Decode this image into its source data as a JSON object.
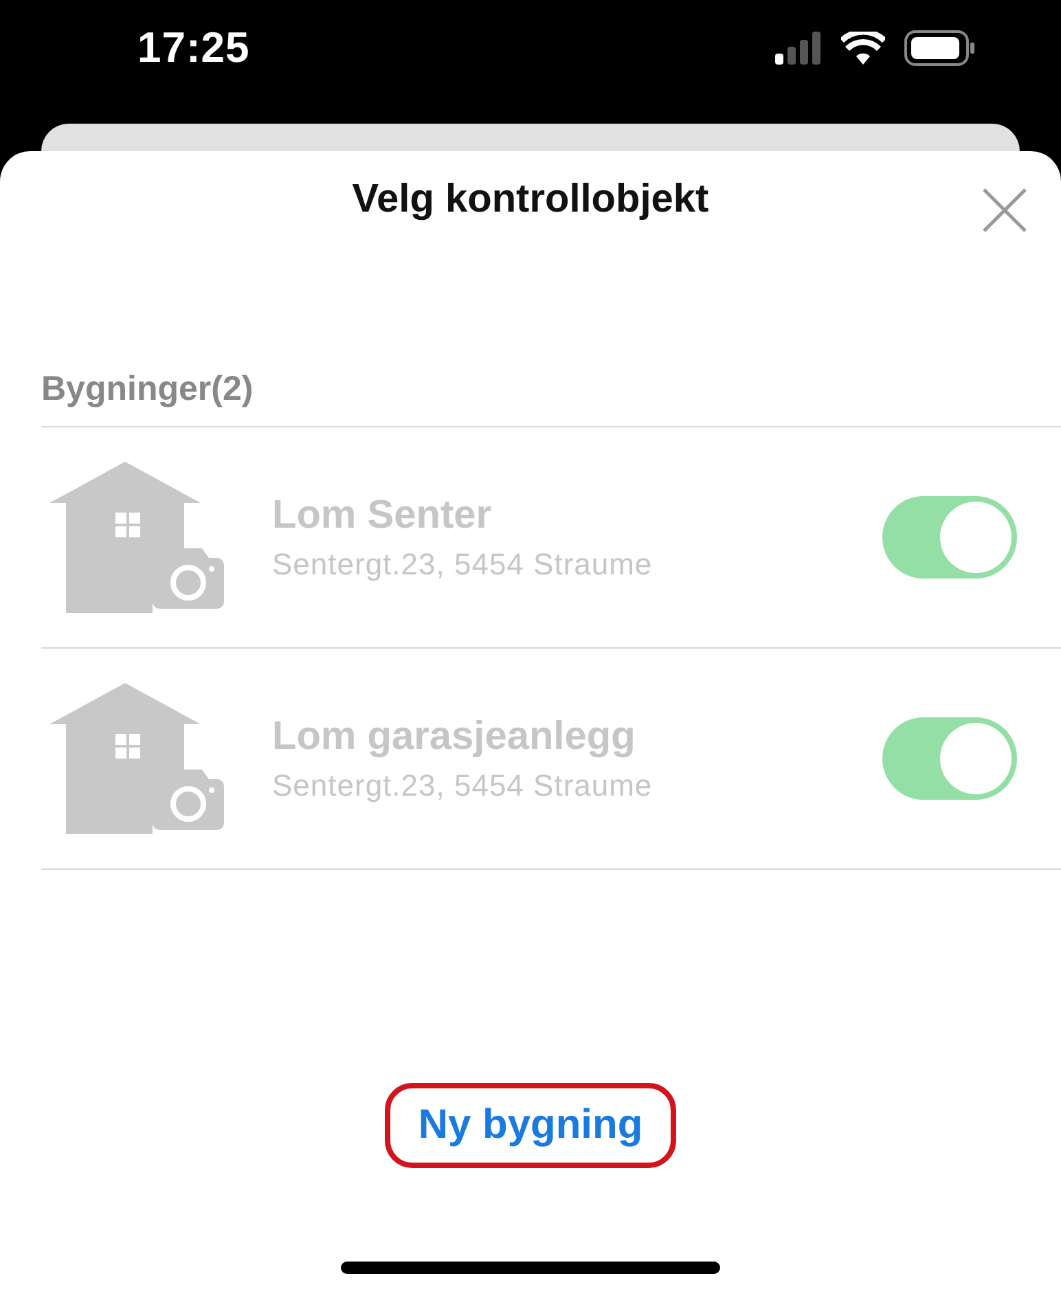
{
  "status_bar": {
    "time": "17:25"
  },
  "sheet": {
    "title": "Velg kontrollobjekt"
  },
  "section": {
    "title": "Bygninger(2)"
  },
  "buildings": [
    {
      "name": "Lom Senter",
      "address": "Sentergt.23, 5454 Straume",
      "disabled": true,
      "on": true
    },
    {
      "name": "Lom garasjeanlegg",
      "address": "Sentergt.23, 5454 Straume",
      "disabled": true,
      "on": true
    }
  ],
  "new_button": {
    "label": "Ny bygning",
    "highlighted": true
  }
}
